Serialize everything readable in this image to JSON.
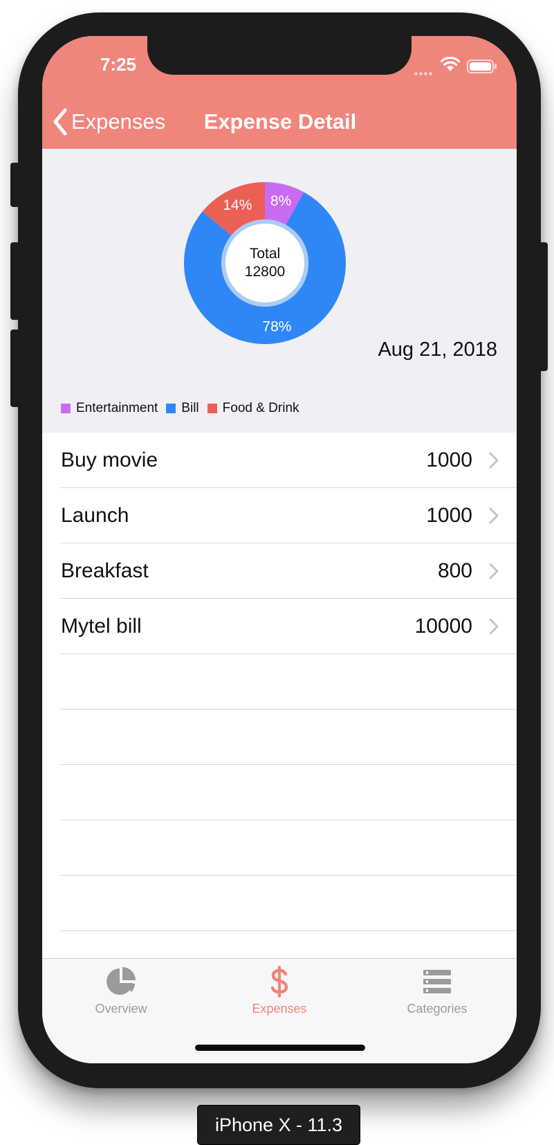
{
  "status_bar": {
    "time": "7:25"
  },
  "nav": {
    "back_label": "Expenses",
    "title": "Expense Detail"
  },
  "colors": {
    "header": "#f0857c",
    "entertainment": "#c96bf2",
    "bill": "#2f87f5",
    "food_drink": "#ec5f55",
    "tab_active": "#f0857c",
    "tab_inactive": "#9b9b9b"
  },
  "chart_data": {
    "type": "pie",
    "center_label": "Total",
    "center_value": "12800",
    "slices": [
      {
        "name": "Entertainment",
        "value": 8,
        "label": "8%",
        "color": "#c96bf2"
      },
      {
        "name": "Bill",
        "value": 78,
        "label": "78%",
        "color": "#2f87f5"
      },
      {
        "name": "Food & Drink",
        "value": 14,
        "label": "14%",
        "color": "#ec5f55"
      }
    ],
    "legend": [
      "Entertainment",
      "Bill",
      "Food & Drink"
    ]
  },
  "date": "Aug 21, 2018",
  "expenses": [
    {
      "name": "Buy movie",
      "amount": "1000"
    },
    {
      "name": "Launch",
      "amount": "1000"
    },
    {
      "name": "Breakfast",
      "amount": "800"
    },
    {
      "name": "Mytel bill",
      "amount": "10000"
    }
  ],
  "tabs": [
    {
      "label": "Overview",
      "icon": "pie-chart-icon",
      "active": false
    },
    {
      "label": "Expenses",
      "icon": "dollar-icon",
      "active": true
    },
    {
      "label": "Categories",
      "icon": "list-icon",
      "active": false
    }
  ],
  "device_label": "iPhone X - 11.3"
}
